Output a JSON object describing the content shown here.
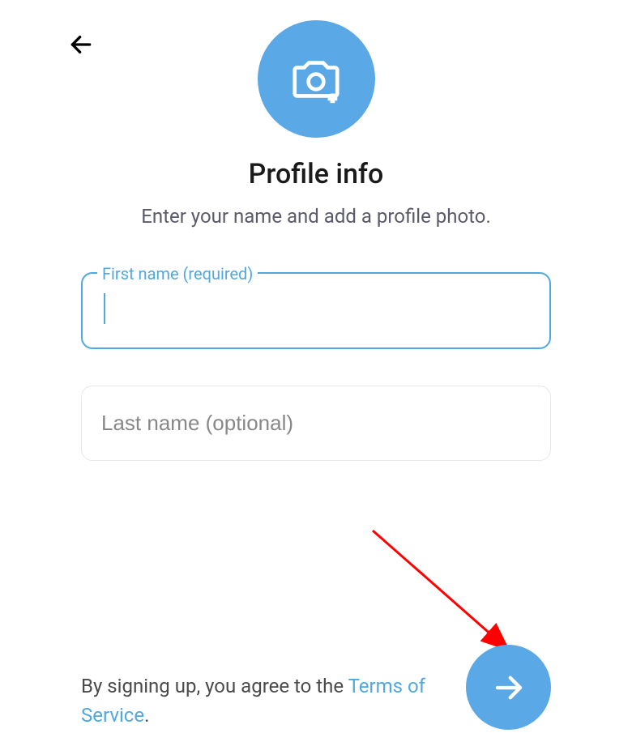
{
  "title": "Profile info",
  "subtitle": "Enter your name and add a profile photo.",
  "fields": {
    "first_name": {
      "label": "First name (required)",
      "value": "",
      "placeholder": ""
    },
    "last_name": {
      "label": "Last name (optional)",
      "value": "",
      "placeholder": "Last name (optional)"
    }
  },
  "footer": {
    "terms_prefix": "By signing up, you agree to the ",
    "terms_link": "Terms of Service",
    "terms_suffix": "."
  },
  "colors": {
    "accent": "#5aa9e6",
    "border_focus": "#4fa8e0",
    "text": "#1a1a1a",
    "subtext": "#5a5a6a"
  }
}
